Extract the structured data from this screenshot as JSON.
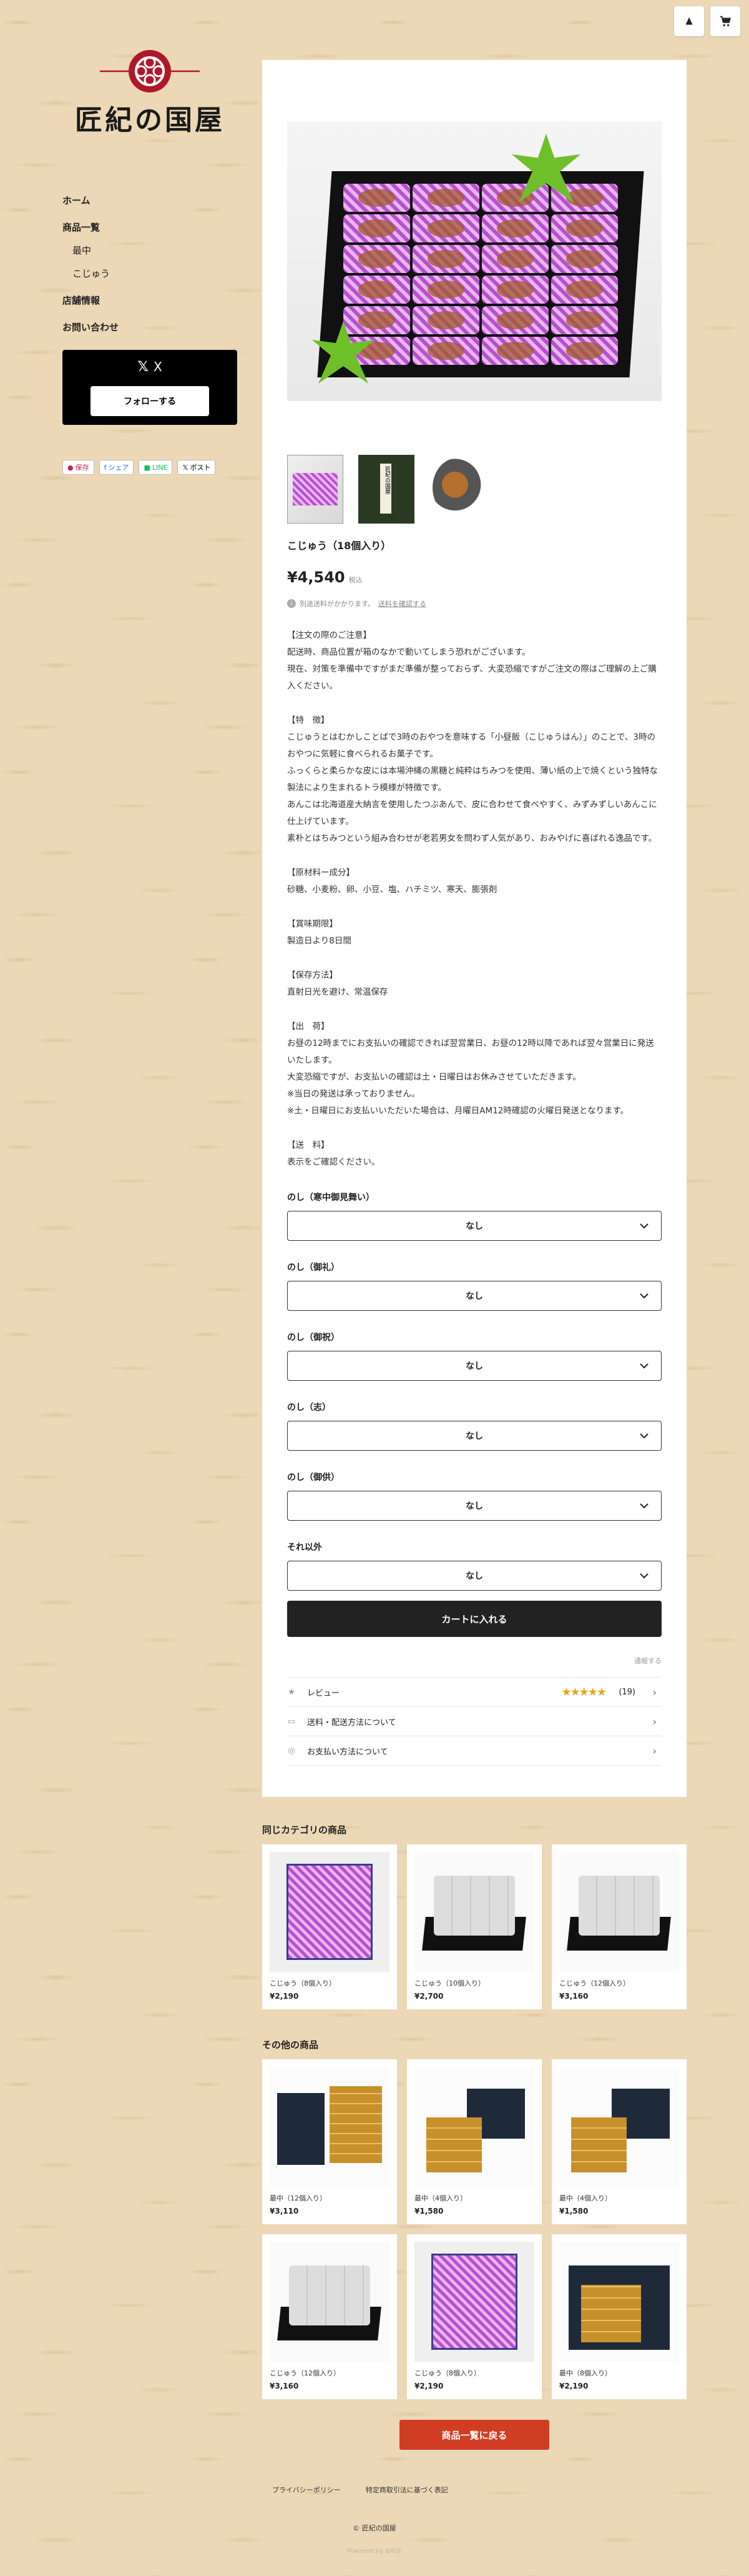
{
  "header": {
    "logo_text": "匠紀の国屋"
  },
  "top_icons": [
    "user-icon",
    "cart-icon"
  ],
  "nav": {
    "home": "ホーム",
    "products": "商品一覧",
    "sub1": "最中",
    "sub2": "こじゅう",
    "store": "店舗情報",
    "contact": "お問い合わせ"
  },
  "follow": {
    "x_label": "X",
    "button": "フォローする"
  },
  "share": {
    "pay": "保存",
    "fb": "シェア",
    "line": "LINE",
    "post": "ポスト"
  },
  "product": {
    "title": "こじゅう（18個入り）",
    "price": "¥4,540",
    "tax": "税込",
    "shipping_prefix": "別途送料がかかります。",
    "shipping_link": "送料を確認する",
    "thumb2_text": "匠紀の国屋",
    "desc": [
      "【注文の際のご注意】\n配送時、商品位置が箱のなかで動いてしまう恐れがございます。\n現在、対策を準備中ですがまだ準備が整っておらず、大変恐縮ですがご注文の際はご理解の上ご購入ください。",
      "【特　徴】\nこじゅうとはむかしことばで3時のおやつを意味する「小昼飯（こじゅうはん）」のことで、3時のおやつに気軽に食べられるお菓子です。\nふっくらと柔らかな皮には本場沖縄の黒糖と純粋はちみつを使用、薄い紙の上で焼くという独特な製法により生まれるトラ模様が特徴です。\nあんこは北海道産大納言を使用したつぶあんで、皮に合わせて食べやすく、みずみずしいあんこに仕上げています。\n素朴とはちみつという組み合わせが老若男女を問わず人気があり、おみやげに喜ばれる逸品です。",
      "【原材料ー成分】\n砂糖、小麦粉、卵、小豆、塩、ハチミツ、寒天、膨張剤",
      "【賞味期限】\n製造日より8日間",
      "【保存方法】\n直射日光を避け、常温保存",
      "【出　荷】\nお昼の12時までにお支払いの確認できれば翌営業日、お昼の12時以降であれば翌々営業日に発送いたします。\n大変恐縮ですが、お支払いの確認は土・日曜日はお休みさせていただきます。\n※当日の発送は承っておりません。\n※土・日曜日にお支払いいただいた場合は、月曜日AM12時確認の火曜日発送となります。",
      "【送　料】\n表示をご確認ください。"
    ],
    "options": [
      {
        "label": "のし（寒中御見舞い）",
        "value": "なし"
      },
      {
        "label": "のし（御礼）",
        "value": "なし"
      },
      {
        "label": "のし（御祝）",
        "value": "なし"
      },
      {
        "label": "のし（志）",
        "value": "なし"
      },
      {
        "label": "のし（御供）",
        "value": "なし"
      },
      {
        "label": "それ以外",
        "value": "なし"
      }
    ],
    "cart_button": "カートに入れる",
    "legal": "通報する",
    "info": {
      "review_label": "レビュー",
      "review_count": "(19)",
      "rating": 4.5,
      "shipping_label": "送料・配送方法について",
      "payment_label": "お支払い方法について"
    }
  },
  "same_category": {
    "title": "同じカテゴリの商品",
    "items": [
      {
        "name": "こじゅう（8個入り）",
        "price": "¥2,190",
        "img": "img-kojyu-purple"
      },
      {
        "name": "こじゅう（10個入り）",
        "price": "¥2,700",
        "img": "img-kojyu-white"
      },
      {
        "name": "こじゅう（12個入り）",
        "price": "¥3,160",
        "img": "img-kojyu-white"
      }
    ]
  },
  "other": {
    "title": "その他の商品",
    "items": [
      {
        "name": "最中（12個入り）",
        "price": "¥3,110",
        "img": "img-monaka-a"
      },
      {
        "name": "最中（4個入り）",
        "price": "¥1,580",
        "img": "img-monaka-b"
      },
      {
        "name": "最中（4個入り）",
        "price": "¥1,580",
        "img": "img-monaka-b"
      },
      {
        "name": "こじゅう（12個入り）",
        "price": "¥3,160",
        "img": "img-kojyu-white"
      },
      {
        "name": "こじゅう（8個入り）",
        "price": "¥2,190",
        "img": "img-kojyu-purple"
      },
      {
        "name": "最中（8個入り）",
        "price": "¥2,190",
        "img": "img-monaka-c"
      }
    ]
  },
  "back_button": "商品一覧に戻る",
  "footer": {
    "privacy": "プライバシーポリシー",
    "law": "特定商取引法に基づく表記",
    "copyright": "© 匠紀の国屋",
    "powered": "Powered by BASE"
  },
  "colors": {
    "accent_red": "#d03d22",
    "star": "#e2a81c",
    "bg": "#ecd8b6"
  }
}
